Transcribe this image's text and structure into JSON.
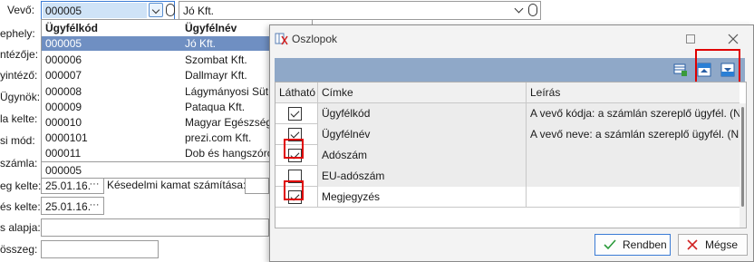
{
  "form": {
    "labels": [
      "Vevő:",
      "ephely:",
      "ntézője:",
      "yintéző:",
      "Ügynök:",
      "la kelte:",
      "si mód:",
      "számla:",
      "eg kelte:",
      "és kelte:",
      "s alapja:",
      "összeg:"
    ],
    "vevo_code": "000005",
    "vevo_name": "Jó Kft.",
    "late_fee_label": "Késedelmi kamat számítása:",
    "date1": "25.01.16.",
    "date2": "25.01.16.",
    "dots": "···"
  },
  "dropdown": {
    "headers": [
      "Ügyfélkód",
      "Ügyfélnév"
    ],
    "rows": [
      {
        "code": "000005",
        "name": "Jó Kft."
      },
      {
        "code": "000006",
        "name": "Szombat Kft."
      },
      {
        "code": "000007",
        "name": "Dallmayr Kft."
      },
      {
        "code": "000008",
        "name": "Lágymányosi Süt"
      },
      {
        "code": "000009",
        "name": "Pataqua Kft."
      },
      {
        "code": "000010",
        "name": "Magyar Egészség"
      },
      {
        "code": "0000101",
        "name": "prezi.com Kft."
      },
      {
        "code": "000011",
        "name": "Dob és hangszóró"
      }
    ],
    "bottom_code": "000005"
  },
  "dialog": {
    "title": "Oszlopok",
    "headers": [
      "Látható",
      "Címke",
      "Leírás"
    ],
    "rows": [
      {
        "visible": true,
        "label": "Ügyfélkód",
        "desc": "A vevő kódja: a számlán szereplő ügyfél. (N"
      },
      {
        "visible": true,
        "label": "Ügyfélnév",
        "desc": "A vevő neve: a számlán szereplő ügyfél. (N"
      },
      {
        "visible": true,
        "label": "Adószám",
        "desc": ""
      },
      {
        "visible": false,
        "label": "EU-adószám",
        "desc": ""
      },
      {
        "visible": true,
        "label": "Megjegyzés",
        "desc": ""
      }
    ],
    "ok_label": "Rendben",
    "cancel_label": "Mégse",
    "highlight_color": "#e00000",
    "selected_row_color": "#6f8fc2"
  }
}
